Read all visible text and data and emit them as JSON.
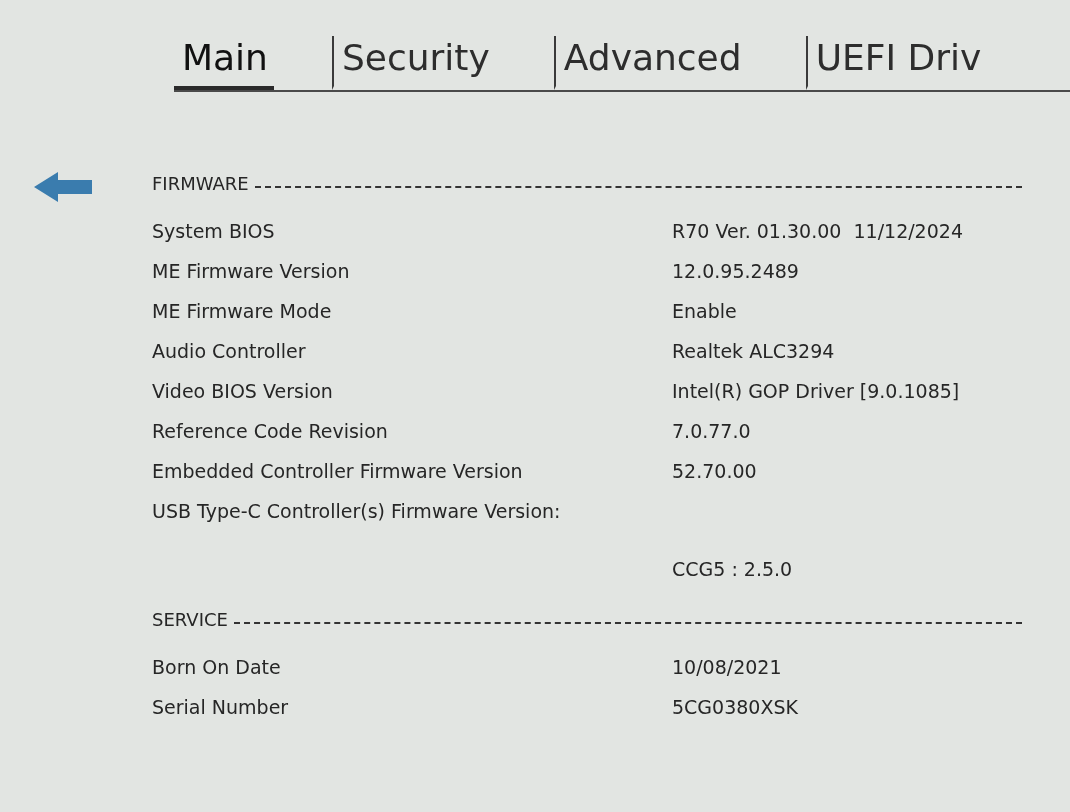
{
  "tabs": [
    {
      "label": "Main",
      "selected": true
    },
    {
      "label": "Security",
      "selected": false
    },
    {
      "label": "Advanced",
      "selected": false
    },
    {
      "label": "UEFI Driv",
      "selected": false
    }
  ],
  "sections": [
    {
      "title": "FIRMWARE",
      "rows": [
        {
          "kind": "inline",
          "label": "System BIOS",
          "value": "R70 Ver. 01.30.00  11/12/2024"
        },
        {
          "kind": "inline",
          "label": "ME Firmware Version",
          "value": "12.0.95.2489"
        },
        {
          "kind": "inline",
          "label": "ME Firmware Mode",
          "value": "Enable"
        },
        {
          "kind": "inline",
          "label": "Audio Controller",
          "value": "Realtek ALC3294"
        },
        {
          "kind": "inline",
          "label": "Video BIOS Version",
          "value": "Intel(R) GOP Driver [9.0.1085]"
        },
        {
          "kind": "inline",
          "label": "Reference Code Revision",
          "value": "7.0.77.0"
        },
        {
          "kind": "inline",
          "label": "Embedded Controller Firmware Version",
          "value": "52.70.00"
        },
        {
          "kind": "wrapped",
          "label": "USB Type-C Controller(s) Firmware Version:",
          "value": "CCG5 : 2.5.0"
        }
      ]
    },
    {
      "title": "SERVICE",
      "rows": [
        {
          "kind": "inline",
          "label": "Born On Date",
          "value": "10/08/2021"
        },
        {
          "kind": "inline",
          "label": "Serial Number",
          "value": "5CG0380XSK"
        }
      ]
    }
  ]
}
